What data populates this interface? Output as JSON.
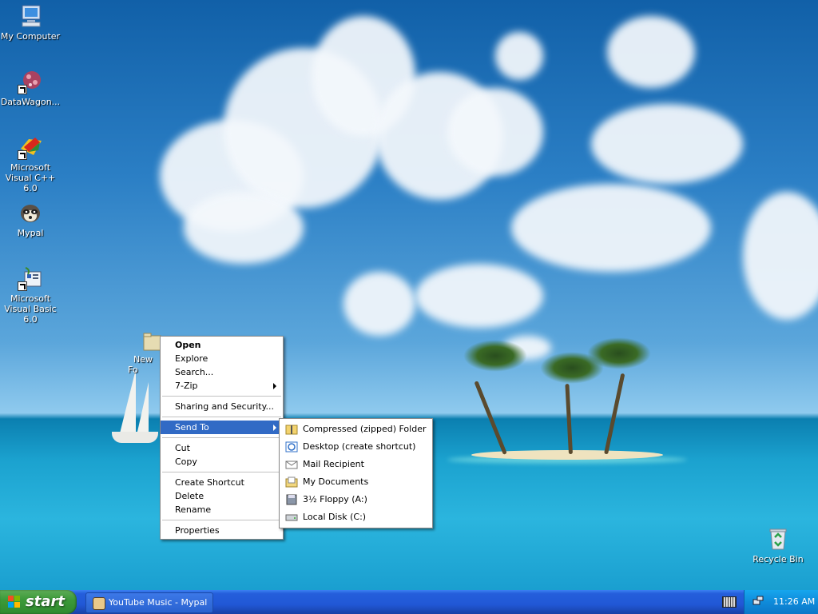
{
  "desktop_icons": [
    {
      "name": "my-computer",
      "label": "My Computer"
    },
    {
      "name": "datawagon",
      "label": "DataWagon..."
    },
    {
      "name": "visual-cpp",
      "label": "Microsoft Visual C++ 6.0"
    },
    {
      "name": "mypal",
      "label": "Mypal"
    },
    {
      "name": "visual-basic",
      "label": "Microsoft Visual Basic 6.0"
    },
    {
      "name": "new-folder",
      "label": "New Fo"
    },
    {
      "name": "recycle-bin",
      "label": "Recycle Bin"
    }
  ],
  "context_menu": {
    "open": "Open",
    "explore": "Explore",
    "search": "Search...",
    "zip": "7-Zip",
    "sharing": "Sharing and Security...",
    "send_to": "Send To",
    "cut": "Cut",
    "copy": "Copy",
    "create_shortcut": "Create Shortcut",
    "delete": "Delete",
    "rename": "Rename",
    "properties": "Properties"
  },
  "send_to_menu": {
    "compressed": "Compressed (zipped) Folder",
    "desktop": "Desktop (create shortcut)",
    "mail": "Mail Recipient",
    "my_documents": "My Documents",
    "floppy": "3½ Floppy (A:)",
    "local_disk": "Local Disk (C:)"
  },
  "taskbar": {
    "start_label": "start",
    "task_label": "YouTube Music - Mypal",
    "clock": "11:26 AM"
  },
  "colors": {
    "menu_highlight": "#316ac5",
    "taskbar_blue": "#245edb",
    "start_green": "#3c9a3a",
    "tray_blue": "#0f8bda"
  }
}
